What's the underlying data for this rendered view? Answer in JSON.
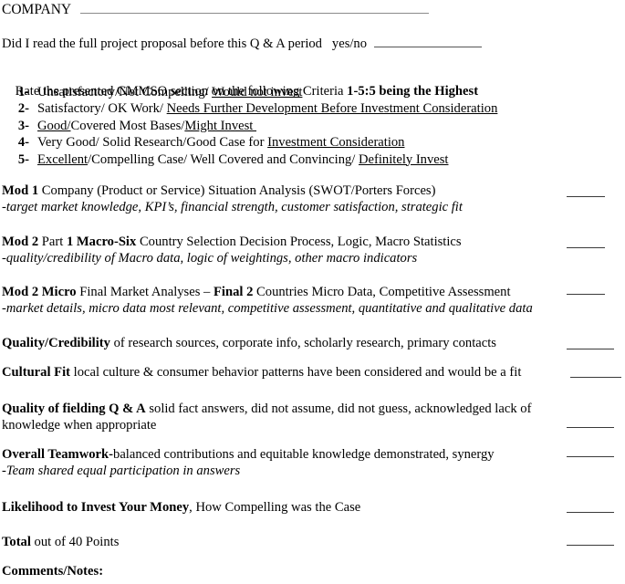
{
  "header": {
    "company_label": "COMPANY",
    "read_question": "Did I read the full project proposal before this Q & A period   yes/no"
  },
  "rate_instruction": {
    "prefix": "Rate the presented GMMSO section on the following Criteria ",
    "bold_tail": "1-5:5 being the Highest"
  },
  "criteria": [
    {
      "num": "1-",
      "parts": [
        {
          "text": "Unsatisfactory/Not Compelling/ ",
          "underline": false
        },
        {
          "text": "Would not invest",
          "underline": true
        }
      ]
    },
    {
      "num": "2-",
      "parts": [
        {
          "text": "Satisfactory/ OK Work/ ",
          "underline": false
        },
        {
          "text": "Needs Further Development Before Investment Consideration",
          "underline": true
        }
      ]
    },
    {
      "num": "3-",
      "parts": [
        {
          "text": "Good/",
          "underline": true
        },
        {
          "text": "Covered Most Bases/",
          "underline": false
        },
        {
          "text": "Might Invest ",
          "underline": true
        }
      ]
    },
    {
      "num": "4-",
      "parts": [
        {
          "text": "Very Good/ Solid Research/Good Case for ",
          "underline": false
        },
        {
          "text": "Investment Consideration",
          "underline": true
        }
      ]
    },
    {
      "num": "5-",
      "parts": [
        {
          "text": "Excellent",
          "underline": true
        },
        {
          "text": "/Compelling Case/ Well Covered and Convincing/ ",
          "underline": false
        },
        {
          "text": "Definitely Invest",
          "underline": true
        }
      ]
    }
  ],
  "sections": [
    {
      "id": "mod-1",
      "line1_bold": "Mod 1",
      "line1_rest": " Company (Product or Service) Situation Analysis (SWOT/Porters Forces)",
      "line2": "-target market knowledge, KPI’s, financial strength, customer satisfaction, strategic fit"
    },
    {
      "id": "mod-2-part-1",
      "line1_bold": "Mod 2",
      "line1_mid": " Part ",
      "line1_bold2": "1 Macro-Six",
      "line1_rest": " Country Selection Decision Process, Logic, Macro Statistics",
      "line2": "-quality/credibility of Macro data, logic of weightings, other macro indicators"
    },
    {
      "id": "mod-2-micro",
      "line1_bold": "Mod 2 Micro",
      "line1_mid": " Final Market Analyses – ",
      "line1_bold2": "Final 2",
      "line1_rest": " Countries Micro Data, Competitive Assessment",
      "line2": "-market details, micro data most relevant, competitive assessment, quantitative and qualitative data"
    },
    {
      "id": "quality-credibility",
      "line1_bold": "Quality/Credibility",
      "line1_rest": " of research sources, corporate info, scholarly research, primary contacts",
      "line2": ""
    },
    {
      "id": "cultural-fit",
      "line1_bold": "Cultural Fit",
      "line1_rest": " local culture & consumer behavior patterns have been considered and would be a fit",
      "line2": ""
    },
    {
      "id": "quality-of-fielding",
      "line1_bold": "Quality of fielding Q & A",
      "line1_rest": " solid fact answers, did not assume, did not guess, acknowledged lack of",
      "line2": "knowledge when appropriate",
      "line2_italic": false
    },
    {
      "id": "overall-teamwork",
      "line1_bold": "Overall Teamwork-",
      "line1_rest": "balanced contributions and equitable knowledge demonstrated, synergy",
      "line2": "-Team shared equal participation in answers"
    },
    {
      "id": "likelihood-to-invest",
      "line1_bold": "Likelihood to Invest Your Money",
      "line1_rest": ", How Compelling was the Case",
      "line2": ""
    },
    {
      "id": "total",
      "line1_bold": "Total",
      "line1_rest": " out of 40 Points",
      "line2": ""
    }
  ],
  "footer": {
    "comments_label": "Comments/Notes:"
  },
  "colors": {
    "text": "#000000",
    "rule": "#3a3a3a",
    "light_rule": "#8b8b8b"
  }
}
